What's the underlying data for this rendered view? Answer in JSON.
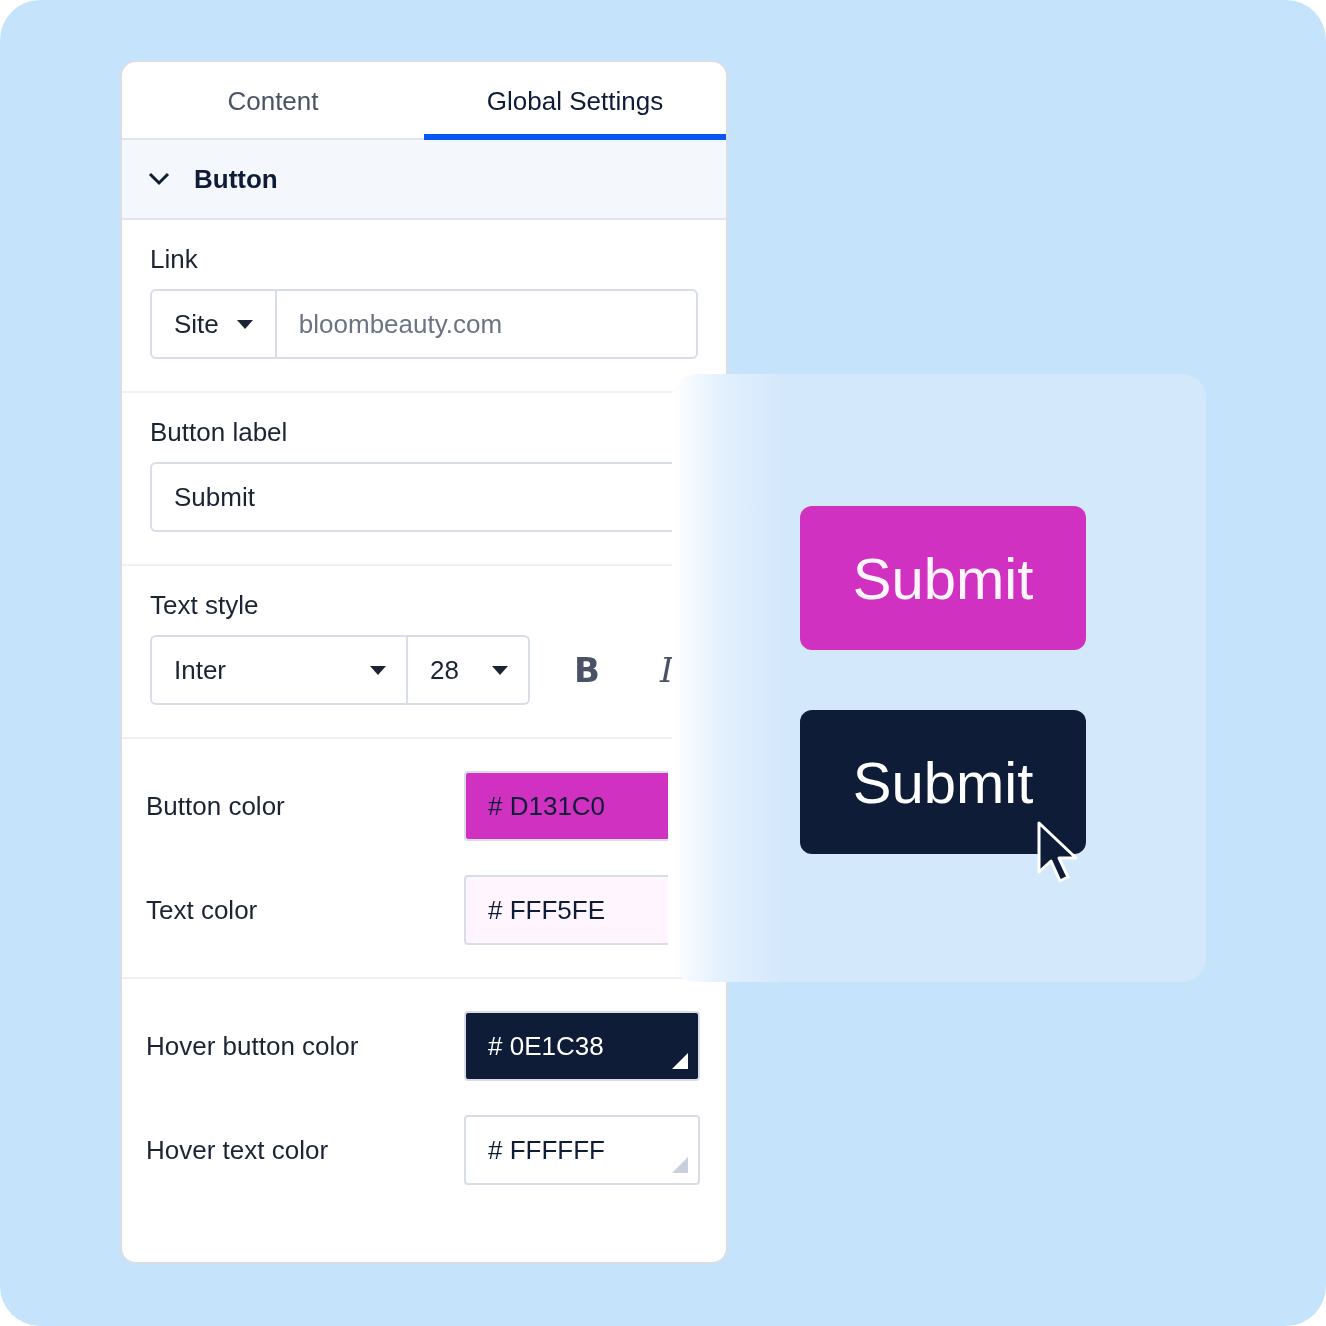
{
  "tabs": [
    {
      "label": "Content",
      "selected": false
    },
    {
      "label": "Global Settings",
      "selected": true
    }
  ],
  "section": {
    "title": "Button",
    "expanded": true
  },
  "link": {
    "label": "Link",
    "type": "Site",
    "placeholder": "bloombeauty.com"
  },
  "button_label": {
    "label": "Button label",
    "value": "Submit"
  },
  "text_style": {
    "label": "Text style",
    "font": "Inter",
    "size": "28",
    "toggles": [
      {
        "label": "B",
        "kind": "bold"
      },
      {
        "label": "I",
        "kind": "italic"
      }
    ]
  },
  "colors": [
    {
      "label": "Button color",
      "value": "# D131C0",
      "color": "#d131c0"
    },
    {
      "label": "Text color",
      "value": "# FFF5FE",
      "color": "#fff5fe"
    }
  ],
  "hover_colors": [
    {
      "label": "Hover button color",
      "value": "# 0E1C38",
      "color": "#0e1c38"
    },
    {
      "label": "Hover text color",
      "value": "# FFFFFF",
      "color": "#ffffff"
    }
  ],
  "preview": {
    "buttons": [
      {
        "label": "Submit",
        "hovered": false
      },
      {
        "label": "Submit",
        "hovered": true
      }
    ]
  }
}
